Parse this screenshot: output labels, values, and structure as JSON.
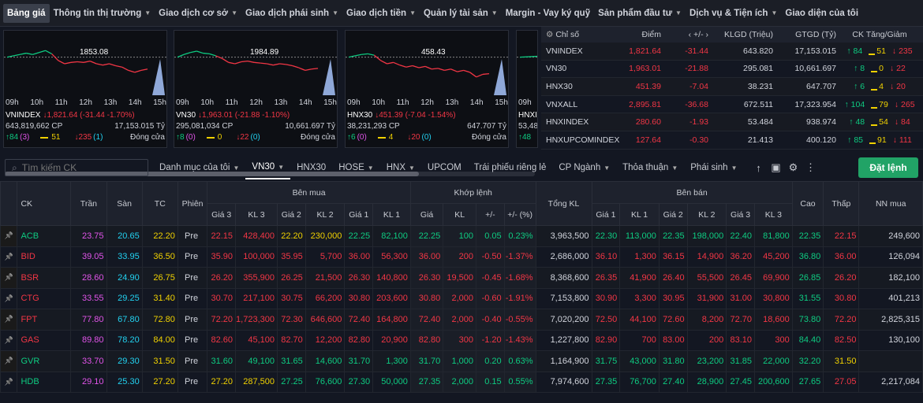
{
  "nav": [
    {
      "label": "Bảng giá",
      "active": true,
      "caret": false
    },
    {
      "label": "Thông tin thị trường",
      "caret": true
    },
    {
      "label": "Giao dịch cơ sở",
      "caret": true
    },
    {
      "label": "Giao dịch phái sinh",
      "caret": true
    },
    {
      "label": "Giao dịch tiền",
      "caret": true
    },
    {
      "label": "Quản lý tài sản",
      "caret": true
    },
    {
      "label": "Margin - Vay ký quỹ",
      "caret": false
    },
    {
      "label": "Sản phẩm đầu tư",
      "caret": true
    },
    {
      "label": "Dịch vụ & Tiện ích",
      "caret": true
    },
    {
      "label": "Giao diện của tôi",
      "caret": false
    }
  ],
  "charts": [
    {
      "name": "VNINDEX",
      "ref": "1853.08",
      "change": "↓1,821.64 (-31.44 -1.70%)",
      "volume": "643,819,662 CP",
      "value": "17,153.015 Tỷ",
      "up": "↑84",
      "up_ce": "(3)",
      "ref_count": "51",
      "down": "↓235",
      "down_fl": "(1)",
      "status": "Đóng cửa",
      "refLevel": 0.4,
      "times": [
        "09h",
        "10h",
        "11h",
        "12h",
        "13h",
        "14h",
        "15h"
      ],
      "line": [
        0.4,
        0.38,
        0.36,
        0.34,
        0.36,
        0.33,
        0.3,
        0.35,
        0.45,
        0.5,
        0.48,
        0.47,
        0.48,
        0.46,
        0.5,
        0.52,
        0.5,
        0.53,
        0.55,
        0.6,
        0.63,
        0.6,
        0.58
      ]
    },
    {
      "name": "VN30",
      "ref": "1984.89",
      "change": "↓1,963.01 (-21.88 -1.10%)",
      "volume": "295,081,034 CP",
      "value": "10,661.697 Tỷ",
      "up": "↑8",
      "up_ce": "(0)",
      "ref_count": "0",
      "down": "↓22",
      "down_fl": "(0)",
      "status": "Đóng cửa",
      "refLevel": 0.4,
      "times": [
        "09h",
        "10h",
        "11h",
        "12h",
        "13h",
        "14h",
        "15h"
      ],
      "line": [
        0.4,
        0.36,
        0.33,
        0.31,
        0.34,
        0.35,
        0.38,
        0.42,
        0.48,
        0.5,
        0.47,
        0.46,
        0.48,
        0.49,
        0.5,
        0.52,
        0.5,
        0.51,
        0.53,
        0.56,
        0.6,
        0.58,
        0.57
      ]
    },
    {
      "name": "HNX30",
      "ref": "458.43",
      "change": "↓451.39 (-7.04 -1.54%)",
      "volume": "38,231,293 CP",
      "value": "647.707 Tỷ",
      "up": "↑6",
      "up_ce": "(0)",
      "ref_count": "4",
      "down": "↓20",
      "down_fl": "(0)",
      "status": "Đóng cửa",
      "refLevel": 0.4,
      "times": [
        "09h",
        "10h",
        "11h",
        "12h",
        "13h",
        "14h",
        "15h"
      ],
      "line": [
        0.4,
        0.38,
        0.36,
        0.35,
        0.37,
        0.45,
        0.5,
        0.48,
        0.52,
        0.55,
        0.53,
        0.56,
        0.54,
        0.58,
        0.57,
        0.6,
        0.58,
        0.62,
        0.6,
        0.63,
        0.7,
        0.66,
        0.65
      ]
    },
    {
      "name": "HNXINDEX",
      "ref": "",
      "change": "",
      "volume": "53,48",
      "value": "",
      "up": "↑48",
      "up_ce": "",
      "ref_count": "",
      "down": "",
      "down_fl": "",
      "status": "",
      "refLevel": 0.4,
      "times": [
        "09h"
      ],
      "line": [
        0.4,
        0.35,
        0.33
      ]
    }
  ],
  "index_table": {
    "headers": {
      "name": "Chỉ số",
      "point": "Điểm",
      "change": "‹ +/- ›",
      "vol": "KLGD (Triệu)",
      "val": "GTGD (Tỷ)",
      "stats": "CK Tăng/Giảm"
    },
    "rows": [
      {
        "name": "VNINDEX",
        "point": "1,821.64",
        "change": "-31.44",
        "vol": "643.820",
        "val": "17,153.015",
        "up": "↑ 84",
        "ref": "51",
        "down": "↓ 235"
      },
      {
        "name": "VN30",
        "point": "1,963.01",
        "change": "-21.88",
        "vol": "295.081",
        "val": "10,661.697",
        "up": "↑ 8",
        "ref": "0",
        "down": "↓ 22"
      },
      {
        "name": "HNX30",
        "point": "451.39",
        "change": "-7.04",
        "vol": "38.231",
        "val": "647.707",
        "up": "↑ 6",
        "ref": "4",
        "down": "↓ 20"
      },
      {
        "name": "VNXALL",
        "point": "2,895.81",
        "change": "-36.68",
        "vol": "672.511",
        "val": "17,323.954",
        "up": "↑ 104",
        "ref": "79",
        "down": "↓ 265"
      },
      {
        "name": "HNXINDEX",
        "point": "280.60",
        "change": "-1.93",
        "vol": "53.484",
        "val": "938.974",
        "up": "↑ 48",
        "ref": "54",
        "down": "↓ 84"
      },
      {
        "name": "HNXUPCOMINDEX",
        "point": "127.64",
        "change": "-0.30",
        "vol": "21.413",
        "val": "400.120",
        "up": "↑ 85",
        "ref": "91",
        "down": "↓ 111"
      }
    ]
  },
  "toolbar": {
    "search_placeholder": "Tìm kiếm CK",
    "tabs": [
      {
        "label": "Danh mục của tôi",
        "caret": true
      },
      {
        "label": "VN30",
        "caret": true,
        "active": true
      },
      {
        "label": "HNX30"
      },
      {
        "label": "HOSE",
        "caret": true
      },
      {
        "label": "HNX",
        "caret": true
      },
      {
        "label": "UPCOM"
      },
      {
        "label": "Trái phiếu riêng lẻ"
      },
      {
        "label": "CP Ngành",
        "caret": true
      },
      {
        "label": "Thỏa thuận",
        "caret": true
      },
      {
        "label": "Phái sinh",
        "caret": true
      }
    ],
    "order_button": "Đặt lệnh"
  },
  "board": {
    "headers": {
      "ck": "CK",
      "tran": "Trần",
      "san": "Sàn",
      "tc": "TC",
      "phien": "Phiên",
      "ben_mua": "Bên mua",
      "khop_lenh": "Khớp lệnh",
      "tong_kl": "Tổng KL",
      "ben_ban": "Bên bán",
      "cao": "Cao",
      "thap": "Thấp",
      "nn_mua": "NN mua",
      "gia3": "Giá 3",
      "kl3": "KL 3",
      "gia2": "Giá 2",
      "kl2": "KL 2",
      "gia1": "Giá 1",
      "kl1": "KL 1",
      "gia": "Giá",
      "kl": "KL",
      "pm": "+/-",
      "pct": "+/- (%)"
    },
    "rows": [
      {
        "sym": "ACB",
        "c": "up",
        "ceil": "23.75",
        "floor": "20.65",
        "ref": "22.20",
        "phien": "Pre",
        "b3": [
          "22.15",
          "428,400",
          "dn"
        ],
        "b2": [
          "22.20",
          "230,000",
          "ref"
        ],
        "b1": [
          "22.25",
          "82,100",
          "up"
        ],
        "m": [
          "22.25",
          "100",
          "0.05",
          "0.23%",
          "up"
        ],
        "tot": "3,963,500",
        "s1": [
          "22.30",
          "113,000",
          "up"
        ],
        "s2": [
          "22.35",
          "198,000",
          "up"
        ],
        "s3": [
          "22.40",
          "81,800",
          "up"
        ],
        "hi": [
          "22.35",
          "up"
        ],
        "lo": [
          "22.15",
          "dn"
        ],
        "nn": "249,600"
      },
      {
        "sym": "BID",
        "c": "dn",
        "ceil": "39.05",
        "floor": "33.95",
        "ref": "36.50",
        "phien": "Pre",
        "b3": [
          "35.90",
          "100,000",
          "dn"
        ],
        "b2": [
          "35.95",
          "5,700",
          "dn"
        ],
        "b1": [
          "36.00",
          "56,300",
          "dn"
        ],
        "m": [
          "36.00",
          "200",
          "-0.50",
          "-1.37%",
          "dn"
        ],
        "tot": "2,686,000",
        "s1": [
          "36.10",
          "1,300",
          "dn"
        ],
        "s2": [
          "36.15",
          "14,900",
          "dn"
        ],
        "s3": [
          "36.20",
          "45,200",
          "dn"
        ],
        "hi": [
          "36.80",
          "up"
        ],
        "lo": [
          "36.00",
          "dn"
        ],
        "nn": "126,094"
      },
      {
        "sym": "BSR",
        "c": "dn",
        "ceil": "28.60",
        "floor": "24.90",
        "ref": "26.75",
        "phien": "Pre",
        "b3": [
          "26.20",
          "355,900",
          "dn"
        ],
        "b2": [
          "26.25",
          "21,500",
          "dn"
        ],
        "b1": [
          "26.30",
          "140,800",
          "dn"
        ],
        "m": [
          "26.30",
          "19,500",
          "-0.45",
          "-1.68%",
          "dn"
        ],
        "tot": "8,368,600",
        "s1": [
          "26.35",
          "41,900",
          "dn"
        ],
        "s2": [
          "26.40",
          "55,500",
          "dn"
        ],
        "s3": [
          "26.45",
          "69,900",
          "dn"
        ],
        "hi": [
          "26.85",
          "up"
        ],
        "lo": [
          "26.20",
          "dn"
        ],
        "nn": "182,100"
      },
      {
        "sym": "CTG",
        "c": "dn",
        "ceil": "33.55",
        "floor": "29.25",
        "ref": "31.40",
        "phien": "Pre",
        "b3": [
          "30.70",
          "217,100",
          "dn"
        ],
        "b2": [
          "30.75",
          "66,200",
          "dn"
        ],
        "b1": [
          "30.80",
          "203,600",
          "dn"
        ],
        "m": [
          "30.80",
          "2,000",
          "-0.60",
          "-1.91%",
          "dn"
        ],
        "tot": "7,153,800",
        "s1": [
          "30.90",
          "3,300",
          "dn"
        ],
        "s2": [
          "30.95",
          "31,900",
          "dn"
        ],
        "s3": [
          "31.00",
          "30,800",
          "dn"
        ],
        "hi": [
          "31.55",
          "up"
        ],
        "lo": [
          "30.80",
          "dn"
        ],
        "nn": "401,213"
      },
      {
        "sym": "FPT",
        "c": "dn",
        "ceil": "77.80",
        "floor": "67.80",
        "ref": "72.80",
        "phien": "Pre",
        "b3": [
          "72.20",
          "1,723,300",
          "dn"
        ],
        "b2": [
          "72.30",
          "646,600",
          "dn"
        ],
        "b1": [
          "72.40",
          "164,800",
          "dn"
        ],
        "m": [
          "72.40",
          "2,000",
          "-0.40",
          "-0.55%",
          "dn"
        ],
        "tot": "7,020,200",
        "s1": [
          "72.50",
          "44,100",
          "dn"
        ],
        "s2": [
          "72.60",
          "8,200",
          "dn"
        ],
        "s3": [
          "72.70",
          "18,600",
          "dn"
        ],
        "hi": [
          "73.80",
          "up"
        ],
        "lo": [
          "72.20",
          "dn"
        ],
        "nn": "2,825,315"
      },
      {
        "sym": "GAS",
        "c": "dn",
        "ceil": "89.80",
        "floor": "78.20",
        "ref": "84.00",
        "phien": "Pre",
        "b3": [
          "82.60",
          "45,100",
          "dn"
        ],
        "b2": [
          "82.70",
          "12,200",
          "dn"
        ],
        "b1": [
          "82.80",
          "20,900",
          "dn"
        ],
        "m": [
          "82.80",
          "300",
          "-1.20",
          "-1.43%",
          "dn"
        ],
        "tot": "1,227,800",
        "s1": [
          "82.90",
          "700",
          "dn"
        ],
        "s2": [
          "83.00",
          "200",
          "dn"
        ],
        "s3": [
          "83.10",
          "300",
          "dn"
        ],
        "hi": [
          "84.40",
          "up"
        ],
        "lo": [
          "82.50",
          "dn"
        ],
        "nn": "130,100"
      },
      {
        "sym": "GVR",
        "c": "up",
        "ceil": "33.70",
        "floor": "29.30",
        "ref": "31.50",
        "phien": "Pre",
        "b3": [
          "31.60",
          "49,100",
          "up"
        ],
        "b2": [
          "31.65",
          "14,600",
          "up"
        ],
        "b1": [
          "31.70",
          "1,300",
          "up"
        ],
        "m": [
          "31.70",
          "1,000",
          "0.20",
          "0.63%",
          "up"
        ],
        "tot": "1,164,900",
        "s1": [
          "31.75",
          "43,000",
          "up"
        ],
        "s2": [
          "31.80",
          "23,200",
          "up"
        ],
        "s3": [
          "31.85",
          "22,000",
          "up"
        ],
        "hi": [
          "32.20",
          "up"
        ],
        "lo": [
          "31.50",
          "ref"
        ],
        "nn": ""
      },
      {
        "sym": "HDB",
        "c": "up",
        "ceil": "29.10",
        "floor": "25.30",
        "ref": "27.20",
        "phien": "Pre",
        "b3": [
          "27.20",
          "287,500",
          "ref"
        ],
        "b2": [
          "27.25",
          "76,600",
          "up"
        ],
        "b1": [
          "27.30",
          "50,000",
          "up"
        ],
        "m": [
          "27.35",
          "2,000",
          "0.15",
          "0.55%",
          "up"
        ],
        "tot": "7,974,600",
        "s1": [
          "27.35",
          "76,700",
          "up"
        ],
        "s2": [
          "27.40",
          "28,900",
          "up"
        ],
        "s3": [
          "27.45",
          "200,600",
          "up"
        ],
        "hi": [
          "27.65",
          "up"
        ],
        "lo": [
          "27.05",
          "dn"
        ],
        "nn": "2,217,084"
      }
    ]
  }
}
